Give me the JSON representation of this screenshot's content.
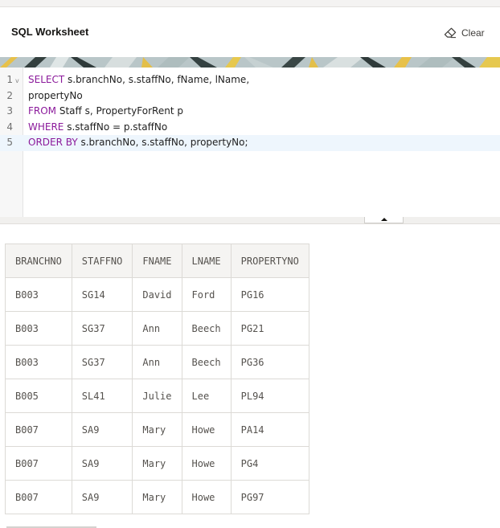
{
  "worksheet": {
    "title": "SQL Worksheet",
    "clear_label": "Clear"
  },
  "editor": {
    "lines": [
      {
        "num": "1",
        "fold": "v",
        "parts": [
          {
            "text": "SELECT",
            "kw": true
          },
          {
            "text": " s.branchNo, s.staffNo, fName, lName,",
            "kw": false
          }
        ]
      },
      {
        "num": "2",
        "parts": [
          {
            "text": "propertyNo",
            "kw": false
          }
        ]
      },
      {
        "num": "3",
        "parts": [
          {
            "text": "FROM",
            "kw": true
          },
          {
            "text": " Staff s, PropertyForRent p",
            "kw": false
          }
        ]
      },
      {
        "num": "4",
        "parts": [
          {
            "text": "WHERE",
            "kw": true
          },
          {
            "text": " s.staffNo = p.staffNo",
            "kw": false
          }
        ]
      },
      {
        "num": "5",
        "parts": [
          {
            "text": "ORDER BY",
            "kw": true
          },
          {
            "text": " s.branchNo, s.staffNo, propertyNo;",
            "kw": false
          }
        ]
      }
    ],
    "active_line": 5
  },
  "results": {
    "columns": [
      "BRANCHNO",
      "STAFFNO",
      "FNAME",
      "LNAME",
      "PROPERTYNO"
    ],
    "rows": [
      [
        "B003",
        "SG14",
        "David",
        "Ford",
        "PG16"
      ],
      [
        "B003",
        "SG37",
        "Ann",
        "Beech",
        "PG21"
      ],
      [
        "B003",
        "SG37",
        "Ann",
        "Beech",
        "PG36"
      ],
      [
        "B005",
        "SL41",
        "Julie",
        "Lee",
        "PL94"
      ],
      [
        "B007",
        "SA9",
        "Mary",
        "Howe",
        "PA14"
      ],
      [
        "B007",
        "SA9",
        "Mary",
        "Howe",
        "PG4"
      ],
      [
        "B007",
        "SA9",
        "Mary",
        "Howe",
        "PG97"
      ]
    ]
  },
  "colors": {
    "keyword": "#8b1a9b",
    "active_line": "#eef6fd"
  },
  "icons": {
    "clear": "eraser-icon",
    "splitter": "chevron-up-icon"
  }
}
